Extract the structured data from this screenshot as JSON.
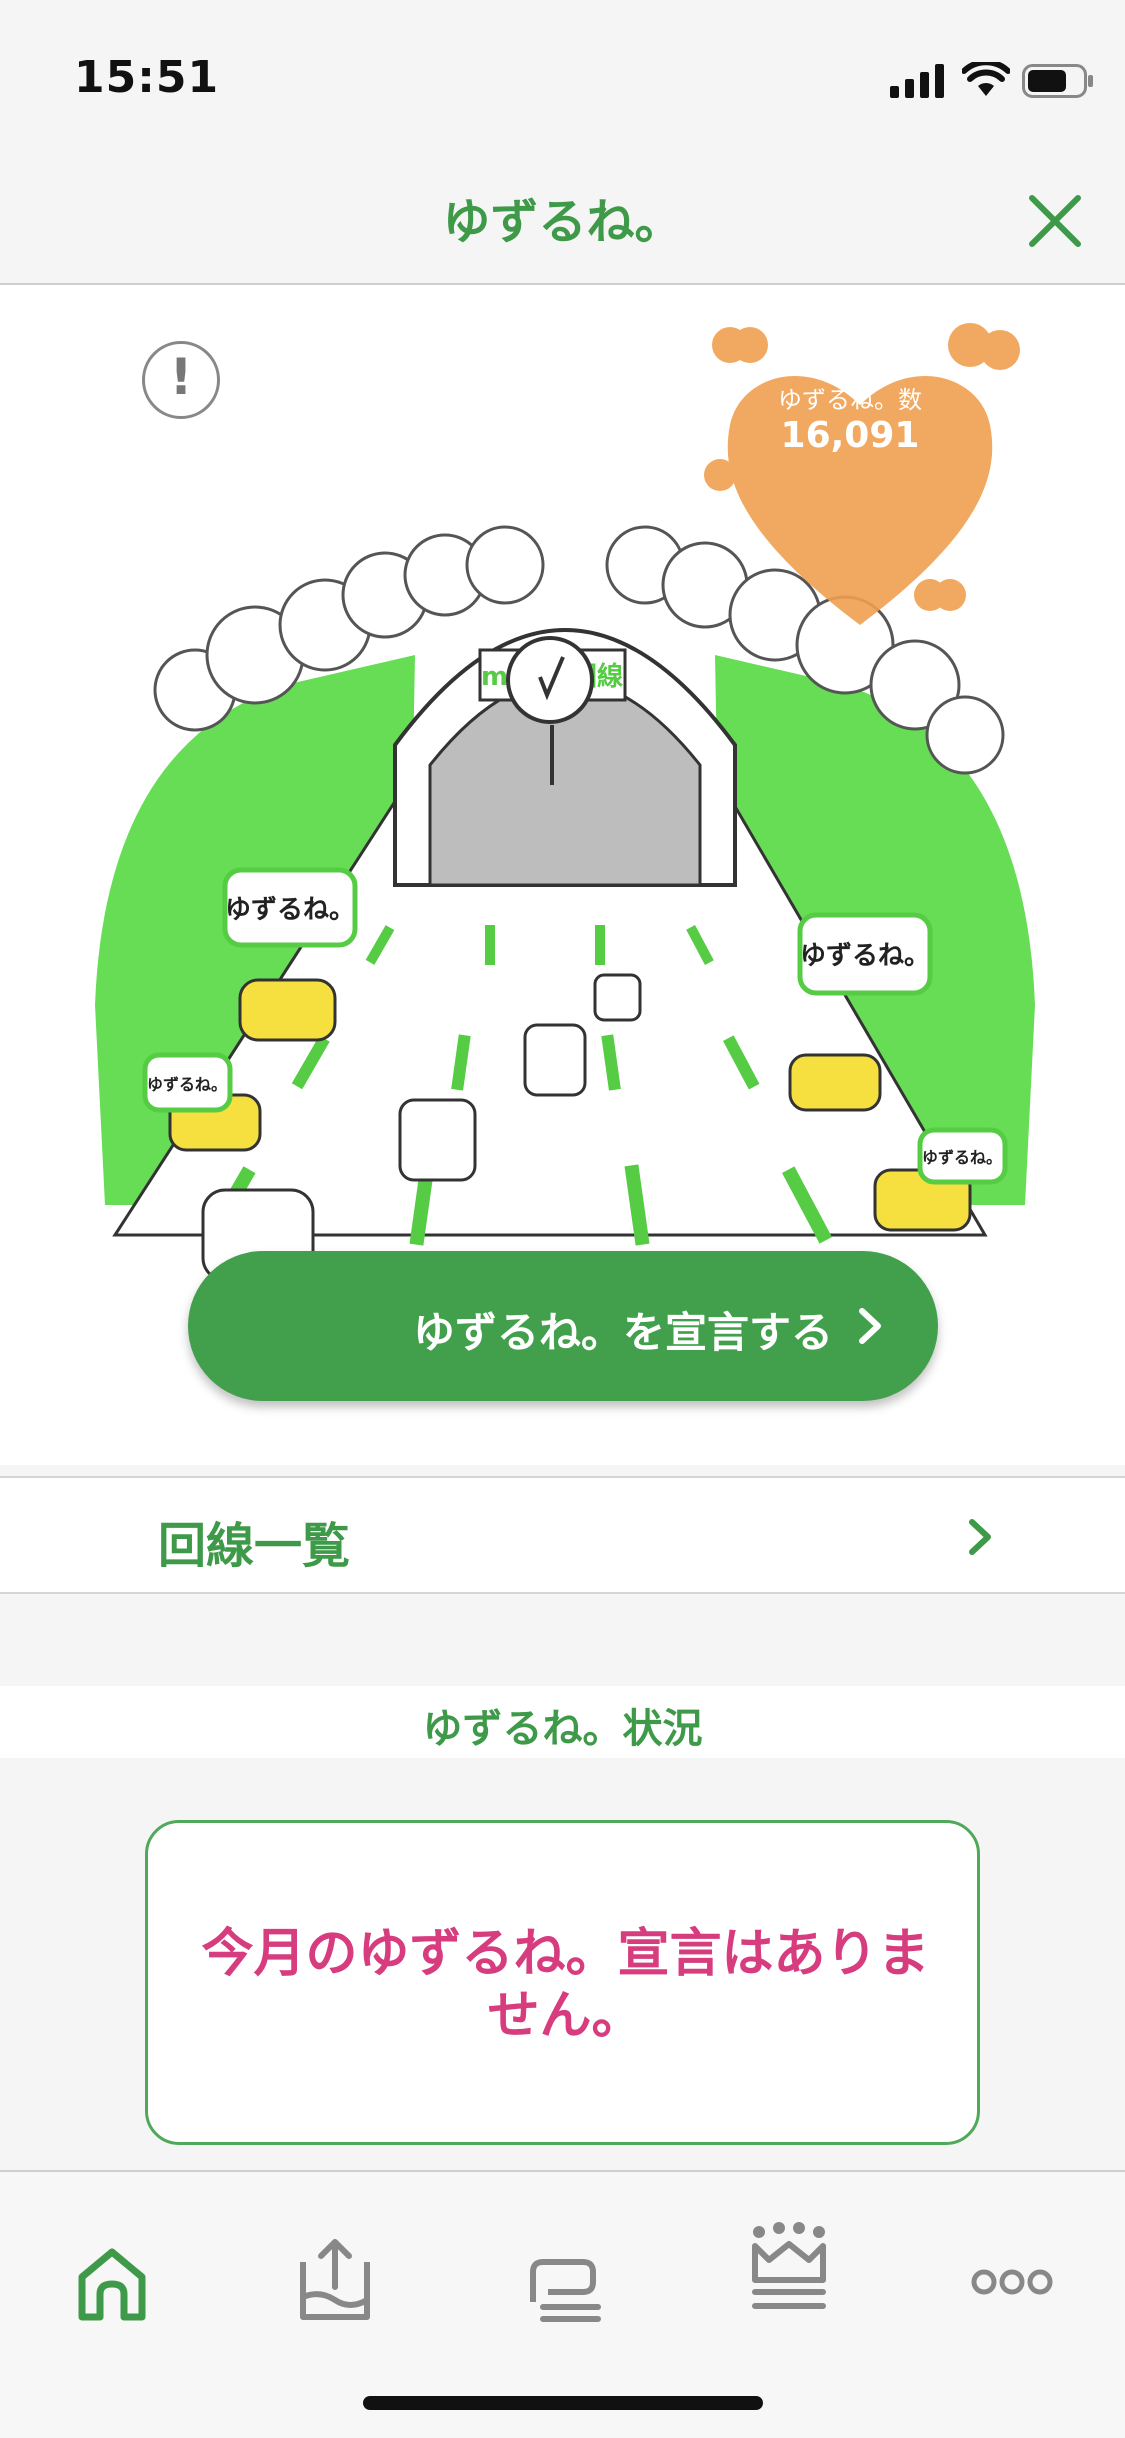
{
  "status_bar": {
    "time": "15:51"
  },
  "header": {
    "title": "ゆずるね。"
  },
  "hero": {
    "count_label": "ゆずるね。数",
    "count_value": "16,091",
    "sign_text": "mineo回線",
    "bubble_text": "ゆずるね。"
  },
  "actions": {
    "declare_label": "ゆずるね。を宣言する"
  },
  "line_list": {
    "label": "回線一覧"
  },
  "status": {
    "title": "ゆずるね。状況",
    "message": "今月のゆずるね。宣言はありません。"
  },
  "tabs": [
    {
      "icon": "home-icon",
      "active": true
    },
    {
      "icon": "upload-tray-icon",
      "active": false
    },
    {
      "icon": "stack-icon",
      "active": false
    },
    {
      "icon": "crown-icon",
      "active": false
    },
    {
      "icon": "more-icon",
      "active": false
    }
  ],
  "colors": {
    "accent": "#3e9a48",
    "button": "#42a04c",
    "alert_text": "#d63c7e",
    "heart": "#f0a050"
  }
}
